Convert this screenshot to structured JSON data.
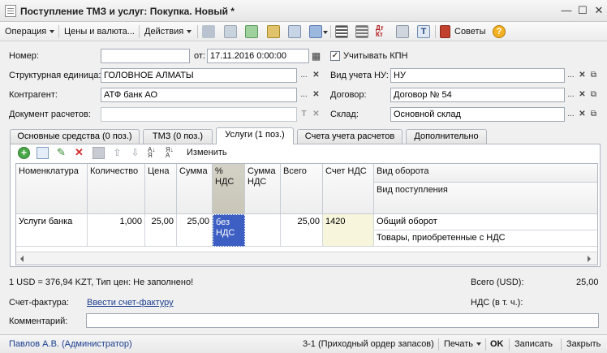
{
  "window": {
    "title": "Поступление ТМЗ и услуг: Покупка. Новый *",
    "minimize": "—",
    "maximize": "☐",
    "close": "✕"
  },
  "toolbar": {
    "operation": "Операция",
    "prices": "Цены и валюта...",
    "actions": "Действия",
    "advice": "Советы",
    "help": "?"
  },
  "form": {
    "number_label": "Номер:",
    "number_value": "",
    "date_label": "от:",
    "date_value": "17.11.2016  0:00:00",
    "kpn_label": "Учитывать КПН",
    "kpn_checked": "✓",
    "unit_label": "Структурная единица:",
    "unit_value": "ГОЛОВНОЕ АЛМАТЫ",
    "nu_label": "Вид учета НУ:",
    "nu_value": "НУ",
    "contractor_label": "Контрагент:",
    "contractor_value": "АТФ банк АО",
    "contract_label": "Договор:",
    "contract_value": "Договор № 54",
    "settlement_label": "Документ расчетов:",
    "settlement_value": "",
    "warehouse_label": "Склад:",
    "warehouse_value": "Основной склад",
    "select_glyph": "...",
    "clear_glyph": "✕",
    "type_glyph": "T"
  },
  "tabs": [
    {
      "label": "Основные средства (0 поз.)"
    },
    {
      "label": "ТМЗ (0 поз.)"
    },
    {
      "label": "Услуги (1 поз.)"
    },
    {
      "label": "Счета учета расчетов"
    },
    {
      "label": "Дополнительно"
    }
  ],
  "grid_toolbar": {
    "edit_label": "Изменить"
  },
  "grid": {
    "headers": {
      "nomenclature": "Номенклатура",
      "quantity": "Количество",
      "price": "Цена",
      "sum": "Сумма",
      "vat_pct": "% НДС",
      "vat_sum": "Сумма НДС",
      "total": "Всего",
      "vat_account": "Счет НДС",
      "turnover": "Вид оборота",
      "receipt": "Вид поступления"
    },
    "rows": [
      {
        "nomenclature": "Услуги банка",
        "quantity": "1,000",
        "price": "25,00",
        "sum": "25,00",
        "vat_pct": "без НДС",
        "vat_sum": "",
        "total": "25,00",
        "vat_account": "1420",
        "turnover": "Общий оборот",
        "receipt": "Товары, приобретенные с НДС"
      }
    ]
  },
  "footer": {
    "rate_info": "1 USD = 376,94 KZT, Тип цен: Не заполнено!",
    "total_label": "Всего (USD):",
    "total_value": "25,00",
    "invoice_label": "Счет-фактура:",
    "invoice_link": "Ввести счет-фактуру",
    "vat_label": "НДС (в т. ч.):",
    "vat_value": "",
    "comment_label": "Комментарий:",
    "comment_value": ""
  },
  "statusbar": {
    "user": "Павлов А.В. (Администратор)",
    "doc_link": "3-1 (Приходный ордер запасов)",
    "print": "Печать",
    "ok": "OK",
    "save": "Записать",
    "close": "Закрыть"
  }
}
